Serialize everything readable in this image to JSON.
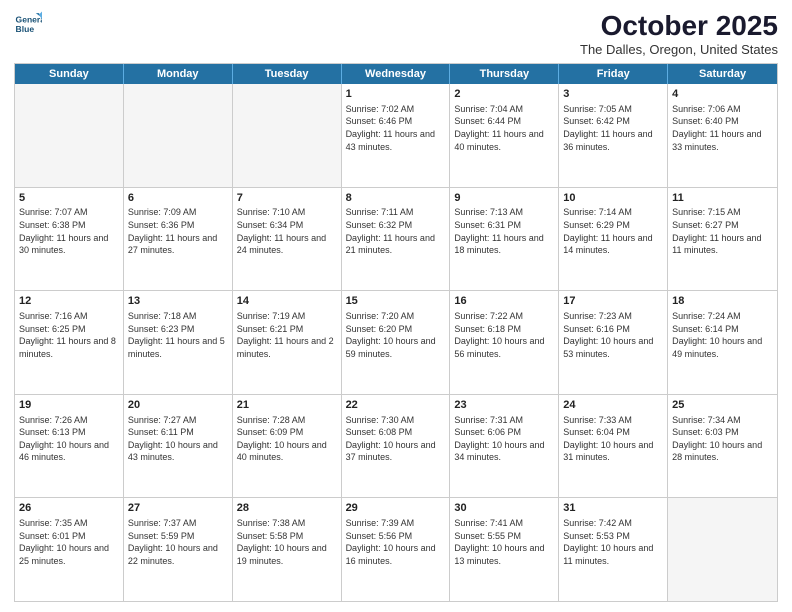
{
  "logo": {
    "line1": "General",
    "line2": "Blue"
  },
  "title": "October 2025",
  "subtitle": "The Dalles, Oregon, United States",
  "header": {
    "days": [
      "Sunday",
      "Monday",
      "Tuesday",
      "Wednesday",
      "Thursday",
      "Friday",
      "Saturday"
    ]
  },
  "weeks": [
    [
      {
        "day": "",
        "info": ""
      },
      {
        "day": "",
        "info": ""
      },
      {
        "day": "",
        "info": ""
      },
      {
        "day": "1",
        "info": "Sunrise: 7:02 AM\nSunset: 6:46 PM\nDaylight: 11 hours\nand 43 minutes."
      },
      {
        "day": "2",
        "info": "Sunrise: 7:04 AM\nSunset: 6:44 PM\nDaylight: 11 hours\nand 40 minutes."
      },
      {
        "day": "3",
        "info": "Sunrise: 7:05 AM\nSunset: 6:42 PM\nDaylight: 11 hours\nand 36 minutes."
      },
      {
        "day": "4",
        "info": "Sunrise: 7:06 AM\nSunset: 6:40 PM\nDaylight: 11 hours\nand 33 minutes."
      }
    ],
    [
      {
        "day": "5",
        "info": "Sunrise: 7:07 AM\nSunset: 6:38 PM\nDaylight: 11 hours\nand 30 minutes."
      },
      {
        "day": "6",
        "info": "Sunrise: 7:09 AM\nSunset: 6:36 PM\nDaylight: 11 hours\nand 27 minutes."
      },
      {
        "day": "7",
        "info": "Sunrise: 7:10 AM\nSunset: 6:34 PM\nDaylight: 11 hours\nand 24 minutes."
      },
      {
        "day": "8",
        "info": "Sunrise: 7:11 AM\nSunset: 6:32 PM\nDaylight: 11 hours\nand 21 minutes."
      },
      {
        "day": "9",
        "info": "Sunrise: 7:13 AM\nSunset: 6:31 PM\nDaylight: 11 hours\nand 18 minutes."
      },
      {
        "day": "10",
        "info": "Sunrise: 7:14 AM\nSunset: 6:29 PM\nDaylight: 11 hours\nand 14 minutes."
      },
      {
        "day": "11",
        "info": "Sunrise: 7:15 AM\nSunset: 6:27 PM\nDaylight: 11 hours\nand 11 minutes."
      }
    ],
    [
      {
        "day": "12",
        "info": "Sunrise: 7:16 AM\nSunset: 6:25 PM\nDaylight: 11 hours\nand 8 minutes."
      },
      {
        "day": "13",
        "info": "Sunrise: 7:18 AM\nSunset: 6:23 PM\nDaylight: 11 hours\nand 5 minutes."
      },
      {
        "day": "14",
        "info": "Sunrise: 7:19 AM\nSunset: 6:21 PM\nDaylight: 11 hours\nand 2 minutes."
      },
      {
        "day": "15",
        "info": "Sunrise: 7:20 AM\nSunset: 6:20 PM\nDaylight: 10 hours\nand 59 minutes."
      },
      {
        "day": "16",
        "info": "Sunrise: 7:22 AM\nSunset: 6:18 PM\nDaylight: 10 hours\nand 56 minutes."
      },
      {
        "day": "17",
        "info": "Sunrise: 7:23 AM\nSunset: 6:16 PM\nDaylight: 10 hours\nand 53 minutes."
      },
      {
        "day": "18",
        "info": "Sunrise: 7:24 AM\nSunset: 6:14 PM\nDaylight: 10 hours\nand 49 minutes."
      }
    ],
    [
      {
        "day": "19",
        "info": "Sunrise: 7:26 AM\nSunset: 6:13 PM\nDaylight: 10 hours\nand 46 minutes."
      },
      {
        "day": "20",
        "info": "Sunrise: 7:27 AM\nSunset: 6:11 PM\nDaylight: 10 hours\nand 43 minutes."
      },
      {
        "day": "21",
        "info": "Sunrise: 7:28 AM\nSunset: 6:09 PM\nDaylight: 10 hours\nand 40 minutes."
      },
      {
        "day": "22",
        "info": "Sunrise: 7:30 AM\nSunset: 6:08 PM\nDaylight: 10 hours\nand 37 minutes."
      },
      {
        "day": "23",
        "info": "Sunrise: 7:31 AM\nSunset: 6:06 PM\nDaylight: 10 hours\nand 34 minutes."
      },
      {
        "day": "24",
        "info": "Sunrise: 7:33 AM\nSunset: 6:04 PM\nDaylight: 10 hours\nand 31 minutes."
      },
      {
        "day": "25",
        "info": "Sunrise: 7:34 AM\nSunset: 6:03 PM\nDaylight: 10 hours\nand 28 minutes."
      }
    ],
    [
      {
        "day": "26",
        "info": "Sunrise: 7:35 AM\nSunset: 6:01 PM\nDaylight: 10 hours\nand 25 minutes."
      },
      {
        "day": "27",
        "info": "Sunrise: 7:37 AM\nSunset: 5:59 PM\nDaylight: 10 hours\nand 22 minutes."
      },
      {
        "day": "28",
        "info": "Sunrise: 7:38 AM\nSunset: 5:58 PM\nDaylight: 10 hours\nand 19 minutes."
      },
      {
        "day": "29",
        "info": "Sunrise: 7:39 AM\nSunset: 5:56 PM\nDaylight: 10 hours\nand 16 minutes."
      },
      {
        "day": "30",
        "info": "Sunrise: 7:41 AM\nSunset: 5:55 PM\nDaylight: 10 hours\nand 13 minutes."
      },
      {
        "day": "31",
        "info": "Sunrise: 7:42 AM\nSunset: 5:53 PM\nDaylight: 10 hours\nand 11 minutes."
      },
      {
        "day": "",
        "info": ""
      }
    ]
  ]
}
